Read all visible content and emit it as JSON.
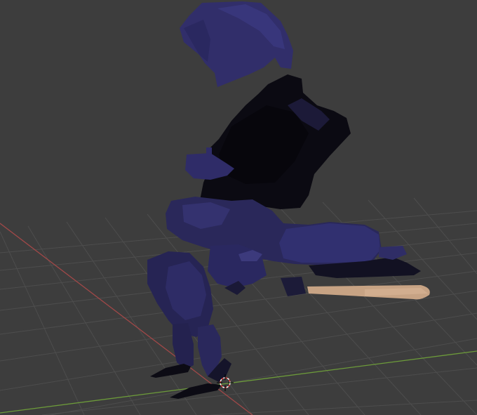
{
  "viewport": {
    "background": "#3d3d3d",
    "grid_color": "#4a4a4a",
    "x_axis_color": "#a05050",
    "y_axis_color": "#6a9a3a",
    "model_dark_color": "#0b0a12",
    "model_purple_color": "#2c2a5c",
    "model_purple_light": "#3b3879",
    "staff_color": "#c8a58a",
    "cursor_icon": "3d-cursor-icon"
  }
}
